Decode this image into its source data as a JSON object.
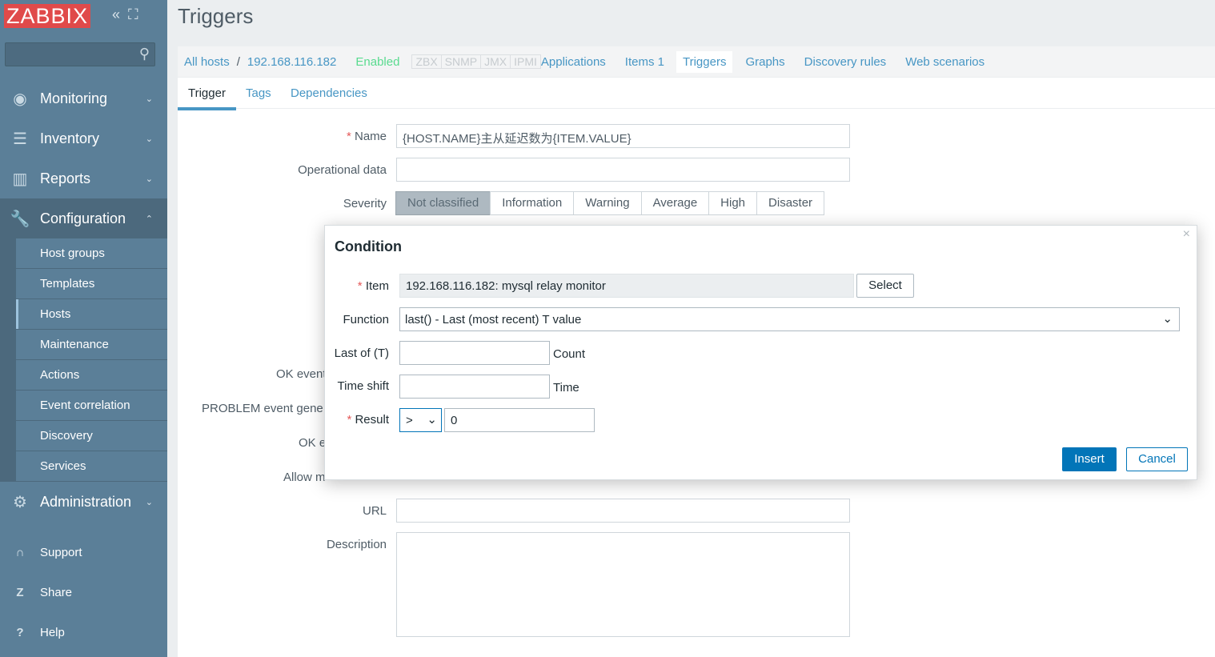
{
  "sidebar": {
    "logo": "ZABBIX",
    "search_placeholder": "",
    "menu": [
      {
        "label": "Monitoring",
        "icon": "eye-icon"
      },
      {
        "label": "Inventory",
        "icon": "list-icon"
      },
      {
        "label": "Reports",
        "icon": "bar-chart-icon"
      },
      {
        "label": "Configuration",
        "icon": "wrench-icon"
      },
      {
        "label": "Administration",
        "icon": "gear-icon"
      }
    ],
    "submenu": [
      "Host groups",
      "Templates",
      "Hosts",
      "Maintenance",
      "Actions",
      "Event correlation",
      "Discovery",
      "Services"
    ],
    "selected_submenu": "Hosts",
    "bottom": [
      {
        "label": "Support",
        "icon": "headset-icon"
      },
      {
        "label": "Share",
        "icon": "share-icon"
      },
      {
        "label": "Help",
        "icon": "help-icon"
      }
    ]
  },
  "header": {
    "title": "Triggers"
  },
  "hostnav": {
    "all_hosts": "All hosts",
    "sep": "/",
    "host": "192.168.116.182",
    "status": "Enabled",
    "badges": [
      "ZBX",
      "SNMP",
      "JMX",
      "IPMI"
    ],
    "links": [
      "Applications",
      "Items 1",
      "Triggers",
      "Graphs",
      "Discovery rules",
      "Web scenarios"
    ],
    "active": "Triggers"
  },
  "tabs": [
    "Trigger",
    "Tags",
    "Dependencies"
  ],
  "form": {
    "name_label": "Name",
    "name_value": "{HOST.NAME}主从延迟数为{ITEM.VALUE}",
    "opdata_label": "Operational data",
    "opdata_value": "",
    "severity_label": "Severity",
    "severities": [
      "Not classified",
      "Information",
      "Warning",
      "Average",
      "High",
      "Disaster"
    ],
    "severity_selected": "Not classified",
    "ok_event_label": "OK event",
    "problem_label": "PROBLEM event gene",
    "ok_e_label": "OK e",
    "allow_label": "Allow m",
    "url_label": "URL",
    "url_value": "",
    "description_label": "Description",
    "description_value": ""
  },
  "modal": {
    "title": "Condition",
    "item_label": "Item",
    "item_value": "192.168.116.182: mysql relay monitor",
    "select_button": "Select",
    "function_label": "Function",
    "function_value": "last() - Last (most recent) T value",
    "last_of_label": "Last of (T)",
    "last_of_value": "",
    "last_of_unit": "Count",
    "time_shift_label": "Time shift",
    "time_shift_value": "",
    "time_shift_unit": "Time",
    "result_label": "Result",
    "result_operator": ">",
    "result_value": "0",
    "insert_button": "Insert",
    "cancel_button": "Cancel"
  },
  "colors": {
    "sidebar": "#5b7f98",
    "accent": "#4796c4",
    "primary_button": "#0275b8",
    "required": "#e45959",
    "enabled": "#59db8f"
  }
}
